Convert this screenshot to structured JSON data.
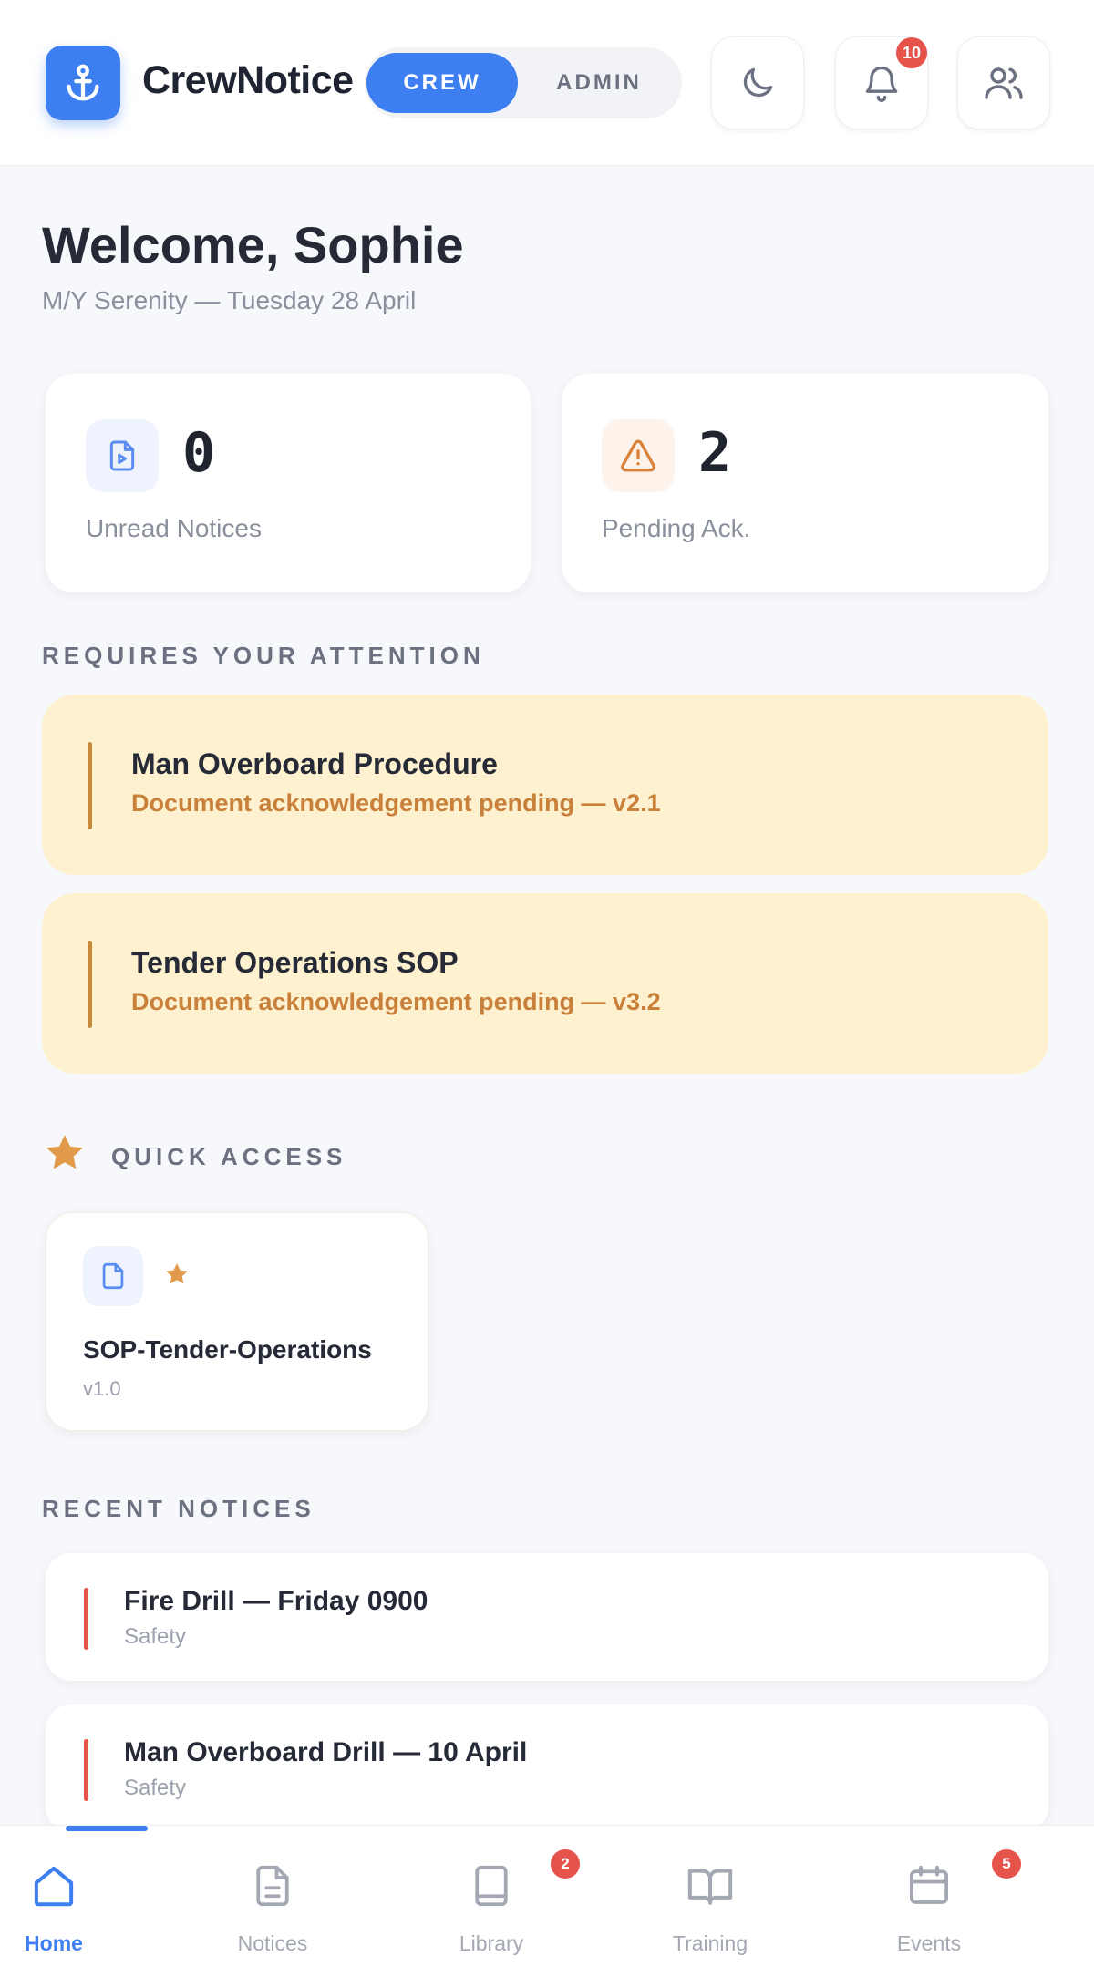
{
  "header": {
    "brand": "CrewNotice",
    "role_toggle": {
      "crew": "CREW",
      "admin": "ADMIN",
      "selected": "CREW"
    },
    "notification_count": "10",
    "icons": [
      "anchor-icon",
      "moon-icon",
      "bell-icon",
      "users-icon"
    ]
  },
  "welcome": {
    "title": "Welcome, Sophie",
    "subtitle": "M/Y Serenity — Tuesday 28 April"
  },
  "stats": {
    "unread": {
      "value": "0",
      "label": "Unread Notices"
    },
    "pending": {
      "value": "2",
      "label": "Pending Ack."
    }
  },
  "attention": {
    "title": "REQUIRES YOUR ATTENTION",
    "items": [
      {
        "title": "Man Overboard Procedure",
        "subtitle": "Document acknowledgement pending — v2.1"
      },
      {
        "title": "Tender Operations SOP",
        "subtitle": "Document acknowledgement pending — v3.2"
      }
    ]
  },
  "quick_access": {
    "title": "QUICK ACCESS",
    "items": [
      {
        "name": "SOP-Tender-Operations",
        "version": "v1.0"
      }
    ]
  },
  "recent": {
    "title": "RECENT NOTICES",
    "items": [
      {
        "title": "Fire Drill — Friday 0900",
        "category": "Safety"
      },
      {
        "title": "Man Overboard Drill — 10 April",
        "category": "Safety"
      }
    ]
  },
  "nav": {
    "items": [
      {
        "label": "Home",
        "active": true
      },
      {
        "label": "Notices"
      },
      {
        "label": "Library",
        "badge": "2"
      },
      {
        "label": "Training"
      },
      {
        "label": "Events",
        "badge": "5"
      }
    ]
  },
  "colors": {
    "accent": "#3d7ff0",
    "attention_bg": "#fdf1cf",
    "attention_text": "#c9803a",
    "danger": "#e5534b"
  }
}
